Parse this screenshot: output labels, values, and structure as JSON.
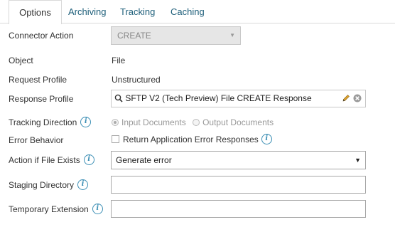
{
  "tabs": [
    {
      "label": "Options",
      "active": true
    },
    {
      "label": "Archiving",
      "active": false
    },
    {
      "label": "Tracking",
      "active": false
    },
    {
      "label": "Caching",
      "active": false
    }
  ],
  "fields": {
    "connector_action": {
      "label": "Connector Action",
      "value": "CREATE"
    },
    "object": {
      "label": "Object",
      "value": "File"
    },
    "request_profile": {
      "label": "Request Profile",
      "value": "Unstructured"
    },
    "response_profile": {
      "label": "Response Profile",
      "value": "SFTP V2 (Tech Preview) File CREATE Response"
    },
    "tracking_direction": {
      "label": "Tracking Direction",
      "options": [
        "Input Documents",
        "Output Documents"
      ],
      "selected": "Input Documents"
    },
    "error_behavior": {
      "label": "Error Behavior",
      "checkbox_label": "Return Application Error Responses",
      "checked": false
    },
    "action_if_file_exists": {
      "label": "Action if File Exists",
      "value": "Generate error"
    },
    "staging_directory": {
      "label": "Staging Directory",
      "value": ""
    },
    "temporary_extension": {
      "label": "Temporary Extension",
      "value": ""
    }
  },
  "info_glyph": "i",
  "colors": {
    "link": "#1e5f7a",
    "info": "#3c8fb5",
    "disabled_bg": "#e6e6e6"
  }
}
